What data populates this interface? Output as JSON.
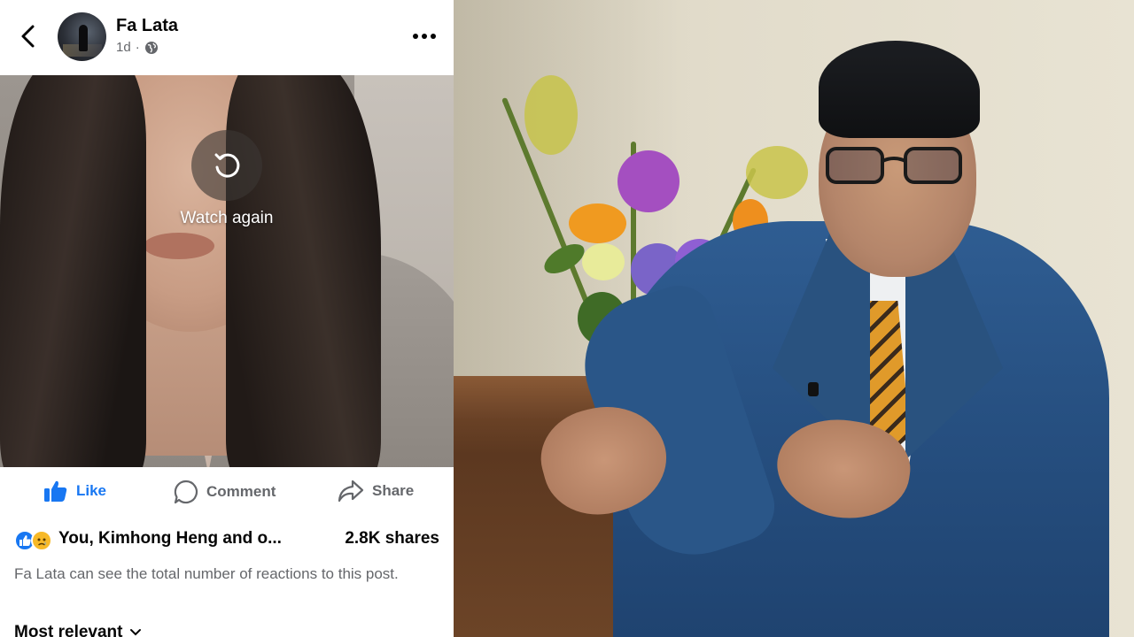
{
  "post": {
    "author": "Fa Lata",
    "age": "1d",
    "separator": "·",
    "video": {
      "overlay_label": "Watch again"
    },
    "actions": {
      "like": "Like",
      "comment": "Comment",
      "share": "Share"
    },
    "reactions": {
      "summary": "You, Kimhong Heng and o...",
      "shares": "2.8K shares",
      "note": "Fa Lata can see the total number of reactions to this post."
    },
    "sort": {
      "selected": "Most relevant"
    }
  },
  "icons": {
    "back": "chevron-left-icon",
    "more": "more-horizontal-icon",
    "audience": "globe-icon",
    "replay": "replay-icon",
    "like": "thumbs-up-icon",
    "comment": "comment-bubble-icon",
    "share": "share-arrow-icon",
    "sort": "chevron-down-icon"
  },
  "colors": {
    "fb_blue": "#1877f2",
    "secondary_text": "#65676b",
    "primary_text": "#050505"
  }
}
